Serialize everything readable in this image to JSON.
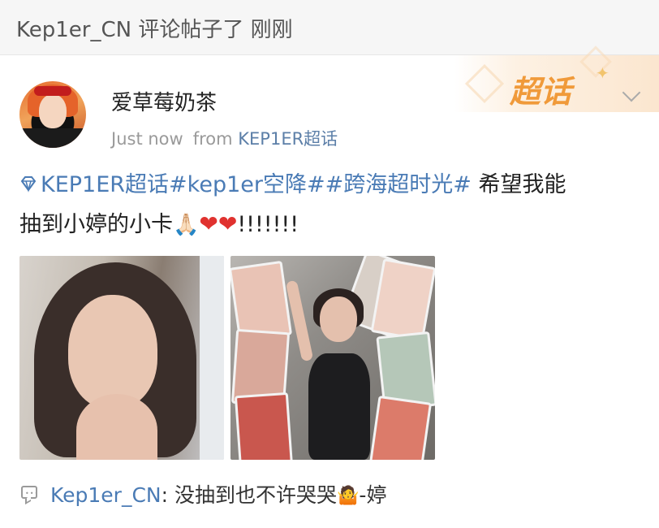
{
  "notification": {
    "text": "Kep1er_CN 评论帖子了 刚刚"
  },
  "post": {
    "username": "爱草莓奶茶",
    "time": "Just now",
    "source_prefix": "from",
    "source": "KEP1ER超话",
    "supertopic_badge": "超话",
    "tags": [
      "KEP1ER超话",
      "#kep1er空降#",
      "#跨海超时光#"
    ],
    "body_line1_rest": "希望我能",
    "body_line2": "抽到小婷的小卡",
    "pray_emoji": "🙏🏻",
    "hearts": [
      "❤",
      "❤"
    ],
    "exclaim": "!!!!!!!",
    "images": [
      {
        "description_icon": "photo-crying-girl"
      },
      {
        "description_icon": "photo-photocards"
      }
    ]
  },
  "comment": {
    "author": "Kep1er_CN",
    "separator": ": ",
    "text_before": "没抽到也不许哭哭",
    "emoji": "🤷",
    "text_after": "-婷"
  },
  "colors": {
    "link": "#4a7bb5",
    "badge": "#f09a3a",
    "heart": "#e0322f",
    "meta": "#9a9a9a"
  }
}
